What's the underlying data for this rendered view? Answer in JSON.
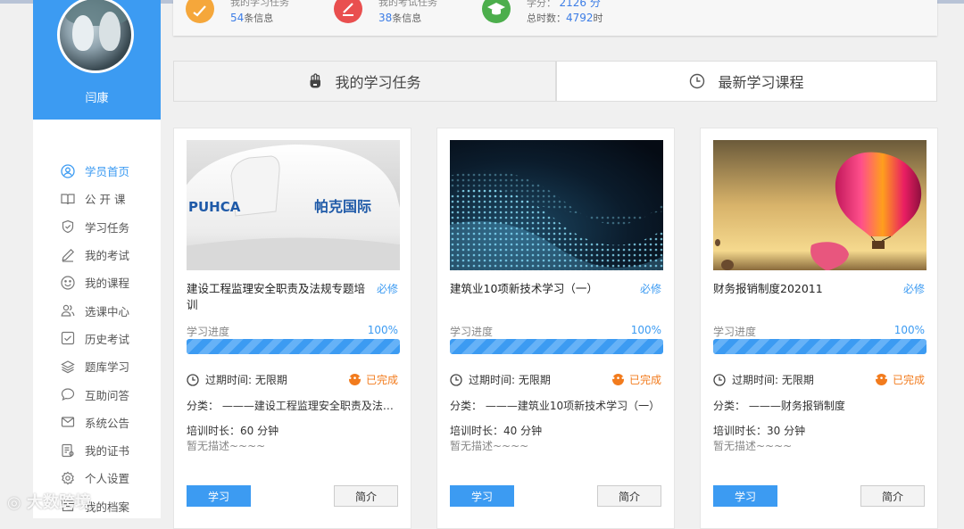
{
  "sidebar": {
    "username": "闫康",
    "menu": [
      {
        "label": "学员首页",
        "icon": "user-circle-icon",
        "active": true
      },
      {
        "label": "公 开 课",
        "icon": "book-open-icon"
      },
      {
        "label": "学习任务",
        "icon": "shield-check-icon"
      },
      {
        "label": "我的考试",
        "icon": "pencil-icon"
      },
      {
        "label": "我的课程",
        "icon": "smile-icon"
      },
      {
        "label": "选课中心",
        "icon": "users-icon"
      },
      {
        "label": "历史考试",
        "icon": "check-square-icon"
      },
      {
        "label": "题库学习",
        "icon": "layers-icon"
      },
      {
        "label": "互助问答",
        "icon": "chat-icon"
      },
      {
        "label": "系统公告",
        "icon": "mail-icon"
      },
      {
        "label": "我的证书",
        "icon": "certificate-icon"
      },
      {
        "label": "个人设置",
        "icon": "gear-icon"
      },
      {
        "label": "我的档案",
        "icon": "archive-icon"
      }
    ]
  },
  "stats": [
    {
      "line1": "我的学习任务",
      "count": "54",
      "suffix": "条信息",
      "color": "#f5a73b"
    },
    {
      "line1": "我的考试任务",
      "count": "38",
      "suffix": "条信息",
      "color": "#e94f4f"
    },
    {
      "line1": "学分：",
      "line1_value": "2126 分",
      "line2_prefix": "总时数：",
      "count": "4792",
      "suffix": "时",
      "color": "#4cae4c"
    }
  ],
  "tabs": {
    "my_tasks": "我的学习任务",
    "latest_courses": "最新学习课程"
  },
  "cards": [
    {
      "title": "建设工程监理安全职责及法规专题培训",
      "required": "必修",
      "progress_label": "学习进度",
      "progress": "100%",
      "expire": "过期时间: 无限期",
      "status": "已完成",
      "category": "分类：    ———建设工程监理安全职责及法规专题培训",
      "duration": "培训时长：60 分钟",
      "description": "暂无描述~~~~",
      "learn_btn": "学习",
      "intro_btn": "简介",
      "helmet_en": "PUHCA",
      "helmet_cn": "帕克国际"
    },
    {
      "title": "建筑业10项新技术学习（一）",
      "required": "必修",
      "progress_label": "学习进度",
      "progress": "100%",
      "expire": "过期时间: 无限期",
      "status": "已完成",
      "category": "分类：    ———建筑业10项新技术学习（一）",
      "duration": "培训时长：40 分钟",
      "description": "暂无描述~~~~",
      "learn_btn": "学习",
      "intro_btn": "简介"
    },
    {
      "title": "财务报销制度202011",
      "required": "必修",
      "progress_label": "学习进度",
      "progress": "100%",
      "expire": "过期时间: 无限期",
      "status": "已完成",
      "category": "分类：    ———财务报销制度",
      "duration": "培训时长：30 分钟",
      "description": "暂无描述~~~~",
      "learn_btn": "学习",
      "intro_btn": "简介"
    }
  ],
  "watermark": "大数跨境"
}
